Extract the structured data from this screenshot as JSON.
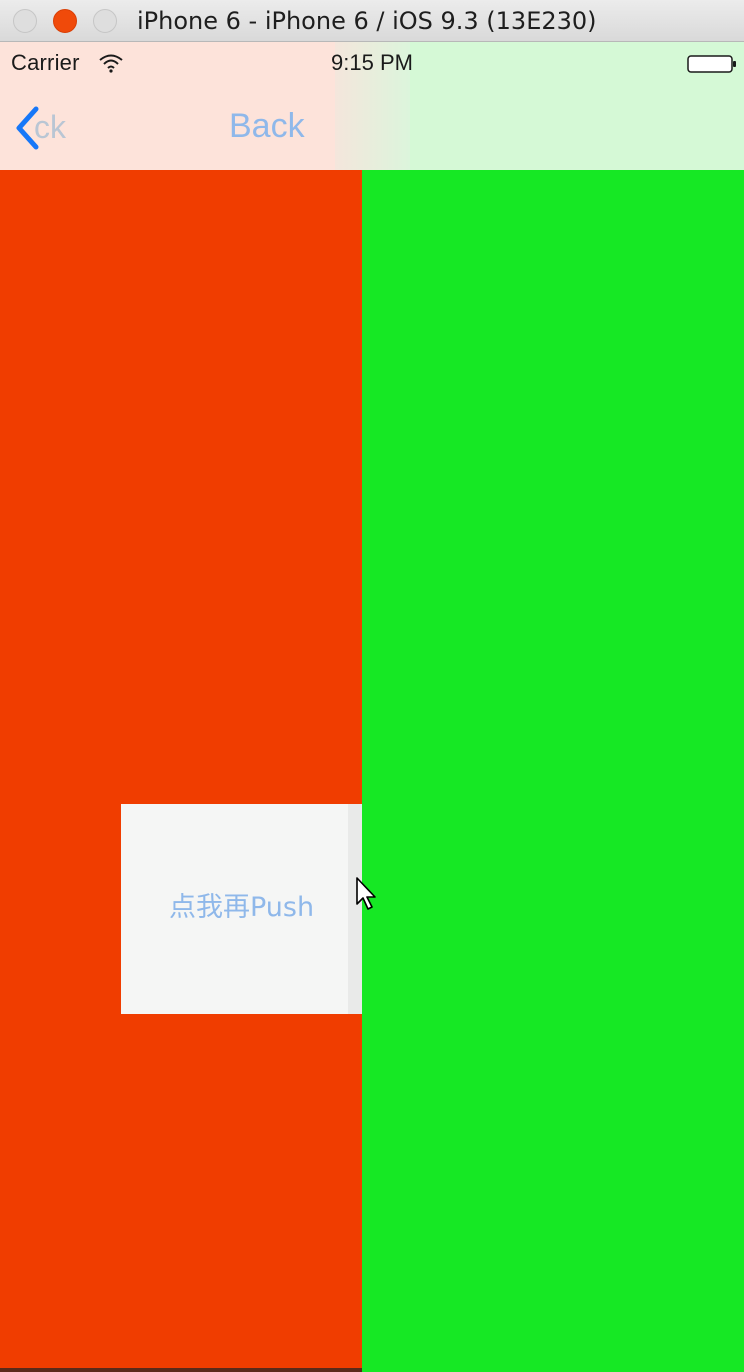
{
  "window": {
    "title": "iPhone 6 - iPhone 6 / iOS 9.3 (13E230)",
    "controls": [
      "close",
      "minimize",
      "zoom"
    ]
  },
  "status_bar": {
    "carrier": "Carrier",
    "time": "9:15 PM",
    "icons": [
      "wifi-icon",
      "battery-icon"
    ]
  },
  "nav_bar": {
    "back_label_faded": "ck",
    "back_label": "Back",
    "back_icon": "chevron-left-icon"
  },
  "screens": {
    "left_color": "#f03d00",
    "right_color": "#16e824"
  },
  "push_button": {
    "label": "点我再Push"
  },
  "colors": {
    "tint_blue": "#1677f8",
    "link_light_blue": "#8fb8ea",
    "nav_left_tint": "#fde3da",
    "nav_right_tint": "#d5f9d6",
    "minimize_red": "#f04a0a"
  }
}
